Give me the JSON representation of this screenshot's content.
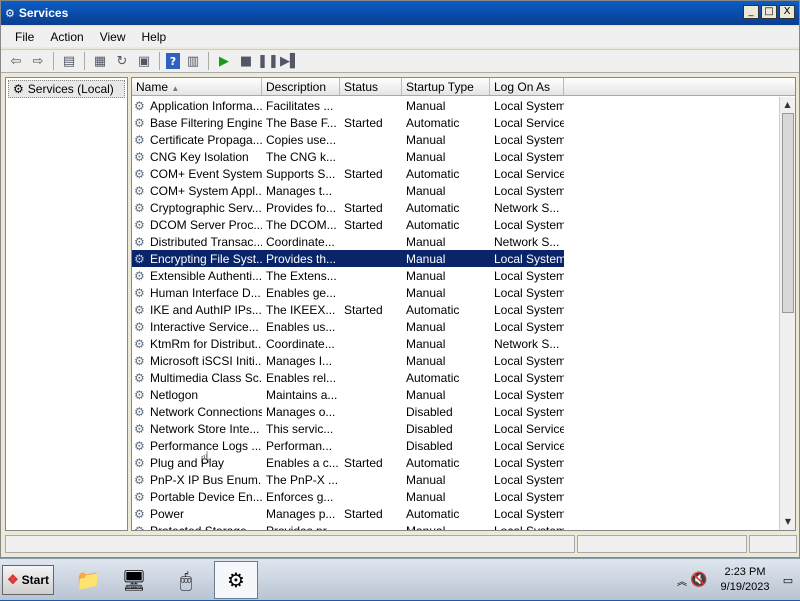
{
  "window": {
    "title": "Services",
    "controls": [
      "_",
      "□",
      "X"
    ]
  },
  "menubar": {
    "items": [
      "File",
      "Action",
      "View",
      "Help"
    ]
  },
  "tree": {
    "root_label": "Services (Local)"
  },
  "table": {
    "columns": [
      "Name",
      "Description",
      "Status",
      "Startup Type",
      "Log On As"
    ],
    "rows": [
      [
        "Application Informa...",
        "Facilitates ...",
        "",
        "Manual",
        "Local System"
      ],
      [
        "Base Filtering Engine",
        "The Base F...",
        "Started",
        "Automatic",
        "Local Service"
      ],
      [
        "Certificate Propaga...",
        "Copies use...",
        "",
        "Manual",
        "Local System"
      ],
      [
        "CNG Key Isolation",
        "The CNG k...",
        "",
        "Manual",
        "Local System"
      ],
      [
        "COM+ Event System",
        "Supports S...",
        "Started",
        "Automatic",
        "Local Service"
      ],
      [
        "COM+ System Appl...",
        "Manages t...",
        "",
        "Manual",
        "Local System"
      ],
      [
        "Cryptographic Serv...",
        "Provides fo...",
        "Started",
        "Automatic",
        "Network S..."
      ],
      [
        "DCOM Server Proc...",
        "The DCOM...",
        "Started",
        "Automatic",
        "Local System"
      ],
      [
        "Distributed Transac...",
        "Coordinate...",
        "",
        "Manual",
        "Network S..."
      ],
      [
        "Encrypting File Syst...",
        "Provides th...",
        "",
        "Manual",
        "Local System"
      ],
      [
        "Extensible Authenti...",
        "The Extens...",
        "",
        "Manual",
        "Local System"
      ],
      [
        "Human Interface D...",
        "Enables ge...",
        "",
        "Manual",
        "Local System"
      ],
      [
        "IKE and AuthIP IPs...",
        "The IKEEX...",
        "Started",
        "Automatic",
        "Local System"
      ],
      [
        "Interactive Service...",
        "Enables us...",
        "",
        "Manual",
        "Local System"
      ],
      [
        "KtmRm for Distribut...",
        "Coordinate...",
        "",
        "Manual",
        "Network S..."
      ],
      [
        "Microsoft iSCSI Initi...",
        "Manages I...",
        "",
        "Manual",
        "Local System"
      ],
      [
        "Multimedia Class Sc...",
        "Enables rel...",
        "",
        "Automatic",
        "Local System"
      ],
      [
        "Netlogon",
        "Maintains a...",
        "",
        "Manual",
        "Local System"
      ],
      [
        "Network Connections",
        "Manages o...",
        "",
        "Disabled",
        "Local System"
      ],
      [
        "Network Store Inte...",
        "This servic...",
        "",
        "Disabled",
        "Local Service"
      ],
      [
        "Performance Logs ...",
        "Performan...",
        "",
        "Disabled",
        "Local Service"
      ],
      [
        "Plug and Play",
        "Enables a c...",
        "Started",
        "Automatic",
        "Local System"
      ],
      [
        "PnP-X IP Bus Enum...",
        "The PnP-X ...",
        "",
        "Manual",
        "Local System"
      ],
      [
        "Portable Device En...",
        "Enforces g...",
        "",
        "Manual",
        "Local System"
      ],
      [
        "Power",
        "Manages p...",
        "Started",
        "Automatic",
        "Local System"
      ],
      [
        "Protected Storage",
        "Provides pr...",
        "",
        "Manual",
        "Local System"
      ]
    ],
    "selected_row": 9
  },
  "taskbar": {
    "start_label": "Start",
    "clock_time": "2:23 PM",
    "clock_date": "9/19/2023"
  }
}
